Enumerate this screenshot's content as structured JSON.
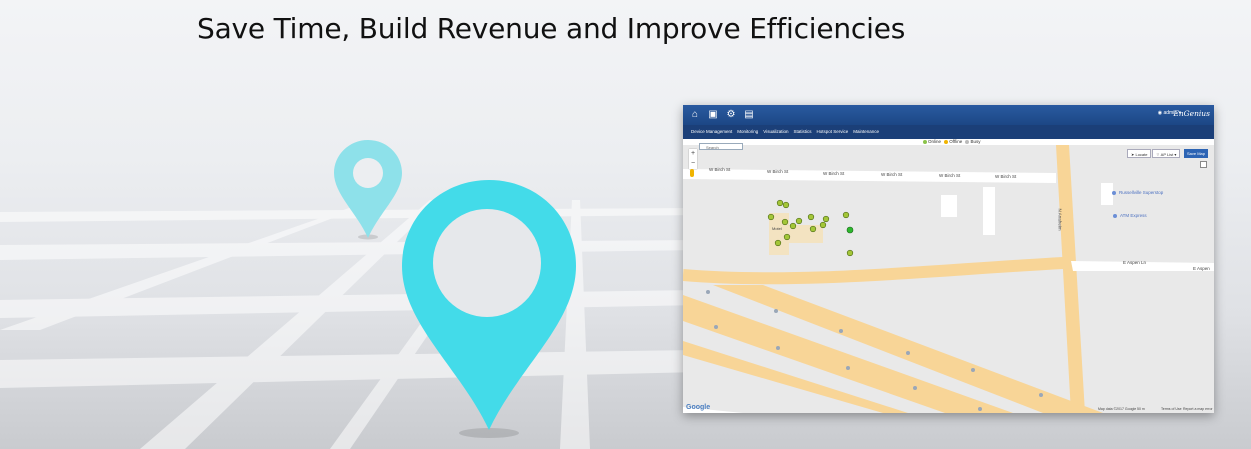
{
  "headline": "Save Time, Build Revenue and Improve Efficiencies",
  "colors": {
    "pin_large": "#43dbe9",
    "pin_small": "#8ee1ea",
    "nav_blue": "#1e4a8c",
    "road_yellow": "#f8d597",
    "map_bg": "#e9e9e9"
  },
  "app": {
    "topbar_icons": [
      "home-icon",
      "device-icon",
      "gear-icon",
      "clipboard-icon"
    ],
    "user": "admin",
    "brand": "EnGenius",
    "menu": [
      "Device Management",
      "Monitoring",
      "Visualization",
      "Statistics",
      "Hotspot Service",
      "Maintenance"
    ],
    "legend": [
      "Online",
      "Offline",
      "Busy"
    ],
    "search_placeholder": "Search",
    "buttons": {
      "locate": "Locate",
      "ap_list": "AP List",
      "save_map": "Save Map"
    },
    "streets": [
      "W Birch St",
      "W Birch St",
      "W Birch St",
      "W Birch St",
      "W Birch St",
      "W Birch St"
    ],
    "street_north": "N Anaheim",
    "street_east": "E Aspen Ln",
    "street_east2": "E Aspen",
    "pois": [
      "Russellville Superstop",
      "ATM Express"
    ],
    "building_label": "Motel",
    "google": "Google",
    "footer": [
      "Map data ©2017 Google",
      "50 m",
      "Terms of Use",
      "Report a map error"
    ]
  }
}
